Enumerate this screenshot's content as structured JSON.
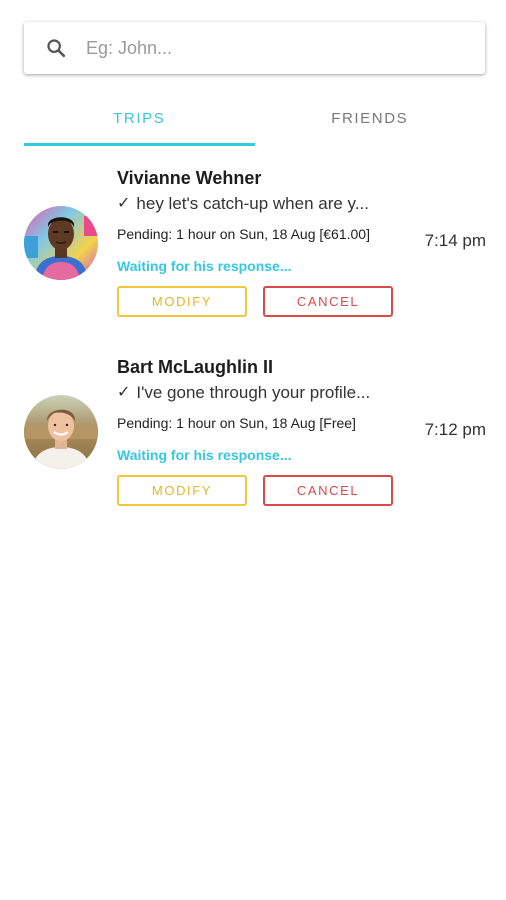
{
  "search": {
    "placeholder": "Eg: John...",
    "icon": "search-icon"
  },
  "tabs": [
    {
      "label": "TRIPS",
      "active": true
    },
    {
      "label": "FRIENDS",
      "active": false
    }
  ],
  "colors": {
    "accent": "#36c8e0",
    "modify": "#f2c73b",
    "cancel": "#d94a4a"
  },
  "trips": [
    {
      "name": "Vivianne Wehner",
      "message": "hey let's catch-up when are y...",
      "pending": "Pending: 1 hour on Sun, 18 Aug [€61.00]",
      "status": "Waiting for his response...",
      "modify_label": "MODIFY",
      "cancel_label": "CANCEL",
      "time": "7:14 pm"
    },
    {
      "name": "Bart McLaughlin II",
      "message": "I've gone through your profile...",
      "pending": "Pending: 1 hour on Sun, 18 Aug [Free]",
      "status": "Waiting for his response...",
      "modify_label": "MODIFY",
      "cancel_label": "CANCEL",
      "time": "7:12 pm"
    }
  ]
}
